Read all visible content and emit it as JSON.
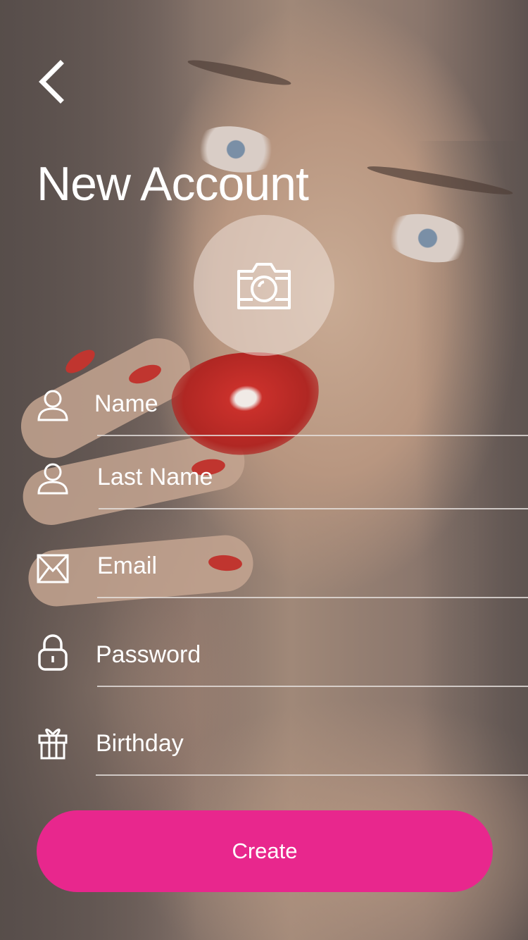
{
  "header": {
    "back_icon": "chevron-left-icon",
    "title": "New Account"
  },
  "avatar": {
    "icon": "camera-icon"
  },
  "form": {
    "fields": [
      {
        "icon": "user-icon",
        "placeholder": "Name",
        "value": ""
      },
      {
        "icon": "user-icon",
        "placeholder": "Last Name",
        "value": ""
      },
      {
        "icon": "envelope-icon",
        "placeholder": "Email",
        "value": ""
      },
      {
        "icon": "lock-icon",
        "placeholder": "Password",
        "value": ""
      },
      {
        "icon": "gift-icon",
        "placeholder": "Birthday",
        "value": ""
      }
    ],
    "submit_label": "Create"
  },
  "colors": {
    "accent": "#e8278d",
    "text": "#ffffff",
    "overlay": "#5e5350"
  }
}
